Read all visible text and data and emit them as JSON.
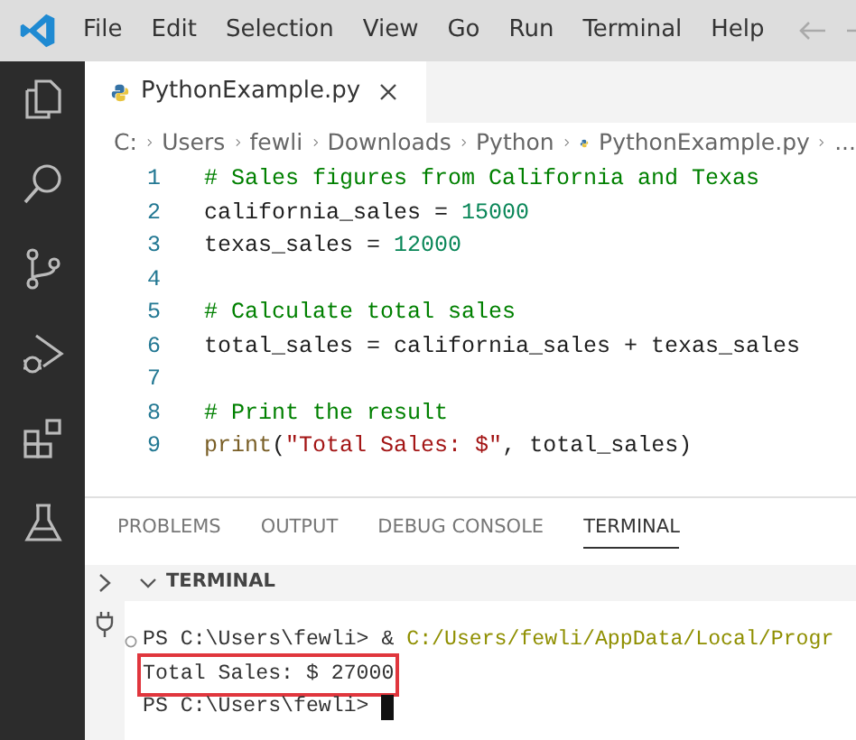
{
  "menu_bar": {
    "items": [
      "File",
      "Edit",
      "Selection",
      "View",
      "Go",
      "Run",
      "Terminal",
      "Help"
    ]
  },
  "activity_bar": {
    "items": [
      {
        "kind": "explorer"
      },
      {
        "kind": "search"
      },
      {
        "kind": "source-control"
      },
      {
        "kind": "run-debug"
      },
      {
        "kind": "extensions"
      },
      {
        "kind": "testing"
      }
    ]
  },
  "editor_tabs": [
    {
      "label": "PythonExample.py",
      "selected": true
    }
  ],
  "breadcrumb": [
    "C:",
    "Users",
    "fewli",
    "Downloads",
    "Python",
    "PythonExample.py",
    "..."
  ],
  "code": {
    "lines": [
      {
        "number": "1",
        "tokens": [
          {
            "kind": "comment",
            "text": "# Sales figures from California and Texas"
          }
        ]
      },
      {
        "number": "2",
        "tokens": [
          {
            "kind": "name",
            "text": "california_sales = "
          },
          {
            "kind": "number",
            "text": "15000"
          }
        ]
      },
      {
        "number": "3",
        "tokens": [
          {
            "kind": "name",
            "text": "texas_sales = "
          },
          {
            "kind": "number",
            "text": "12000"
          }
        ]
      },
      {
        "number": "4"
      },
      {
        "number": "5",
        "tokens": [
          {
            "kind": "comment",
            "text": "# Calculate total sales"
          }
        ]
      },
      {
        "number": "6",
        "tokens": [
          {
            "kind": "name",
            "text": "total_sales = california_sales + texas_sales"
          }
        ]
      },
      {
        "number": "7"
      },
      {
        "number": "8",
        "tokens": [
          {
            "kind": "comment",
            "text": "# Print the result"
          }
        ]
      },
      {
        "number": "9",
        "tokens": [
          {
            "kind": "func",
            "text": "print"
          },
          {
            "kind": "name",
            "text": "("
          },
          {
            "kind": "string",
            "text": "\"Total Sales: $\""
          },
          {
            "kind": "name",
            "text": ", total_sales)"
          }
        ]
      }
    ]
  },
  "panel_tabs": [
    {
      "label": "PROBLEMS",
      "selected": false
    },
    {
      "label": "OUTPUT",
      "selected": false
    },
    {
      "label": "DEBUG CONSOLE",
      "selected": false
    },
    {
      "label": "TERMINAL",
      "selected": true
    }
  ],
  "terminal": {
    "title": "TERMINAL",
    "expanded": true,
    "lines": [
      {
        "decorated": true,
        "highlighted": false,
        "cursor": false,
        "tokens": [
          {
            "kind": "prompt",
            "text": "PS C:\\Users\\fewli> & "
          },
          {
            "kind": "path",
            "text": "C:/Users/fewli/AppData/Local/Progr"
          }
        ]
      },
      {
        "decorated": false,
        "highlighted": true,
        "cursor": false,
        "tokens": [
          {
            "kind": "prompt",
            "text": "Total Sales: $ 27000"
          }
        ]
      },
      {
        "decorated": false,
        "highlighted": false,
        "cursor": true,
        "tokens": [
          {
            "kind": "prompt",
            "text": "PS C:\\Users\\fewli> "
          }
        ]
      }
    ]
  }
}
